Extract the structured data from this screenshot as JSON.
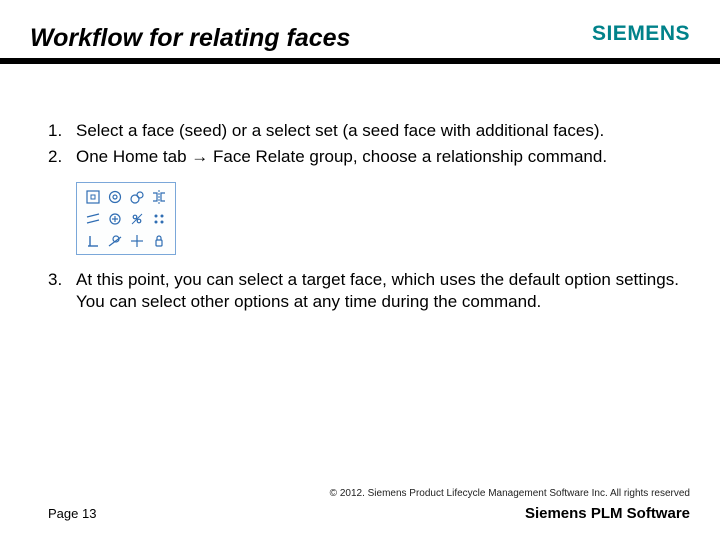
{
  "header": {
    "title": "Workflow for relating faces",
    "logo": "SIEMENS"
  },
  "steps": {
    "n1": "1.",
    "s1": "Select a face (seed) or a select set (a seed face with additional faces).",
    "n2": "2.",
    "s2": "One Home tab → Face Relate group, choose a relationship command.",
    "n3": "3.",
    "s3": "At this point, you can select a target face, which uses the default option settings. You can select other options at any time during the command."
  },
  "icons": {
    "r1c1": "coplanar-icon",
    "r1c2": "concentric-icon",
    "r1c3": "tangent-icon",
    "r1c4": "symmetric-icon",
    "r2c1": "parallel-icon",
    "r2c2": "equal-radius-icon",
    "r2c3": "offset-icon",
    "r2c4": "horizontal-vertical-icon",
    "r3c1": "perpendicular-icon",
    "r3c2": "tangent-touching-icon",
    "r3c3": "ground-icon",
    "r3c4": "rigid-icon"
  },
  "footer": {
    "copyright": "© 2012. Siemens Product Lifecycle Management Software Inc. All rights reserved",
    "page": "Page 13",
    "brand": "Siemens PLM Software"
  }
}
